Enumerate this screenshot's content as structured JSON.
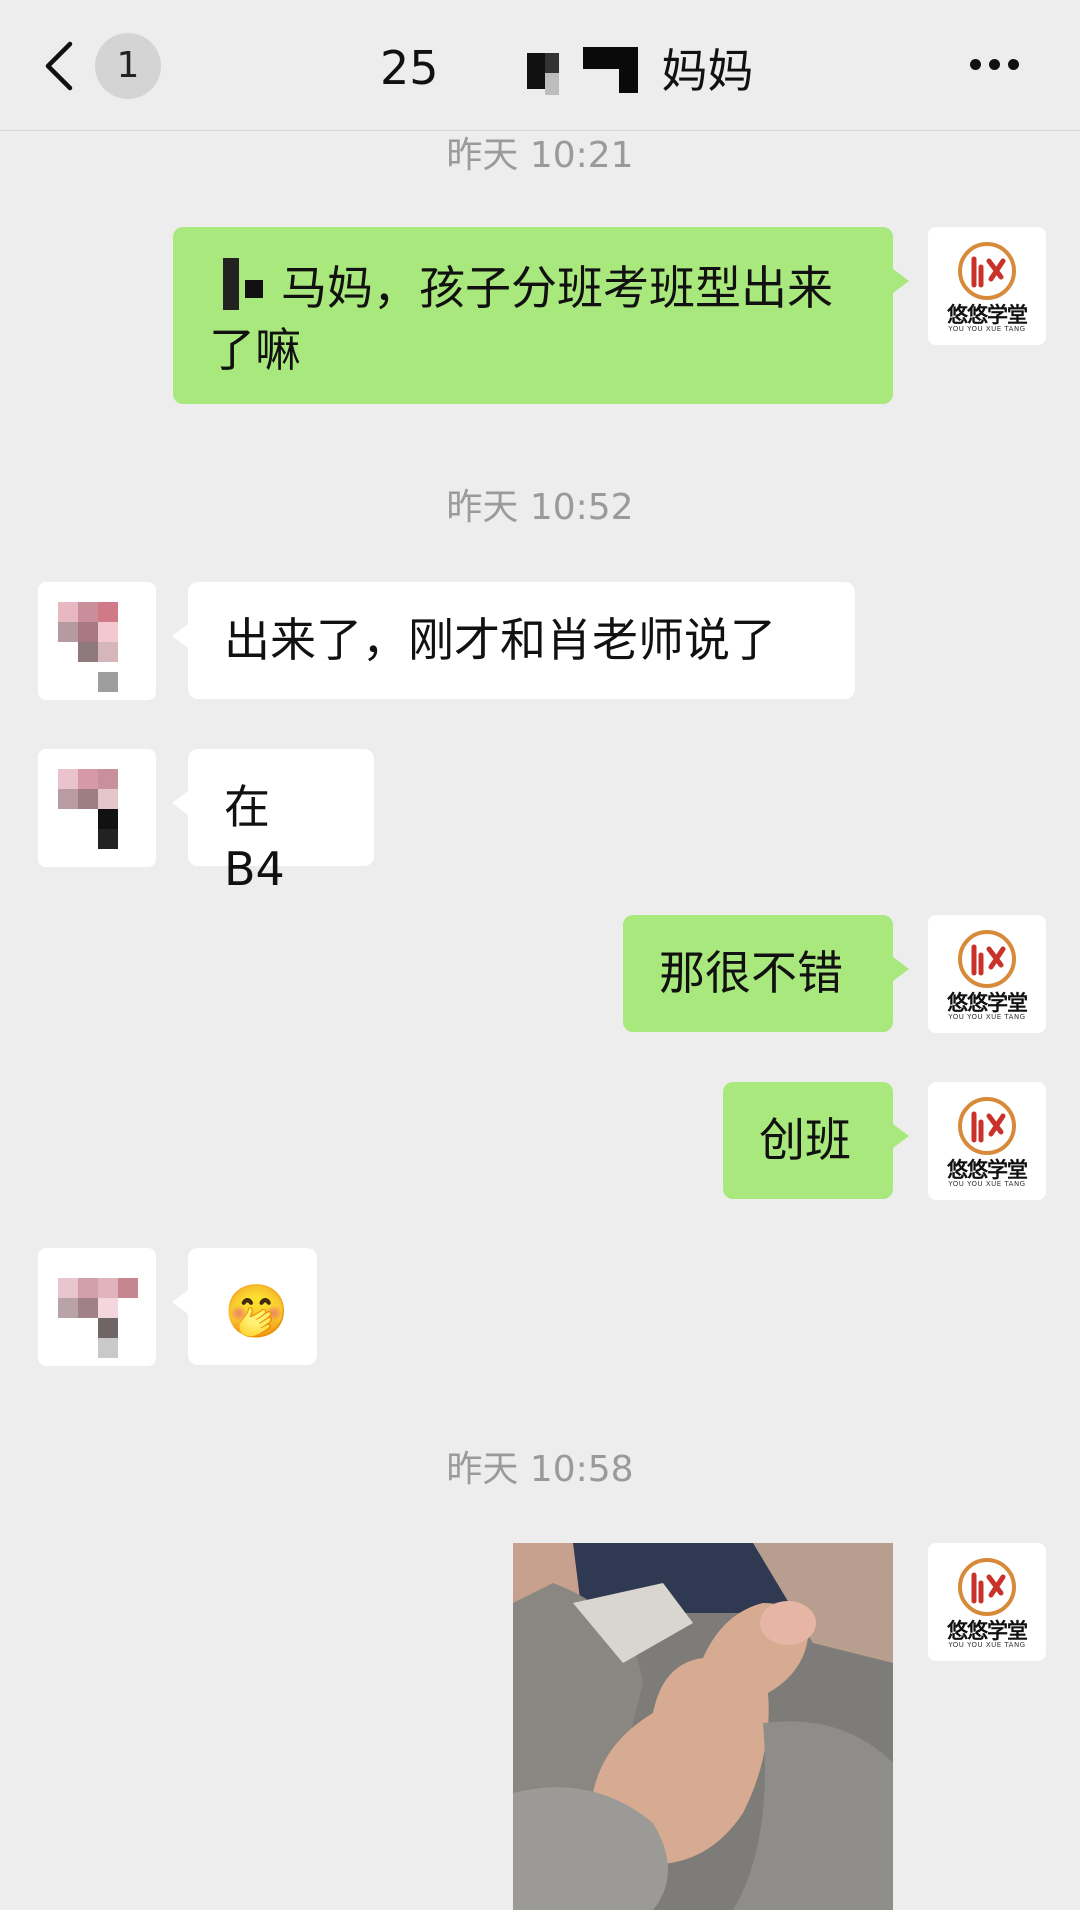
{
  "header": {
    "back_icon": "chevron-left-icon",
    "unread_count": "1",
    "title_prefix": "25",
    "title_suffix": "妈妈",
    "more_icon": "ellipsis-icon"
  },
  "messages": [
    {
      "type": "timestamp",
      "text": "昨天 10:21"
    },
    {
      "type": "text",
      "side": "out",
      "text_visible": "马妈，孩子分班考班型出来了嘛"
    },
    {
      "type": "timestamp",
      "text": "昨天 10:52"
    },
    {
      "type": "text",
      "side": "in",
      "text": "出来了，刚才和肖老师说了"
    },
    {
      "type": "text",
      "side": "in",
      "text": "在 B4"
    },
    {
      "type": "text",
      "side": "out",
      "text": "那很不错"
    },
    {
      "type": "text",
      "side": "out",
      "text": "创班"
    },
    {
      "type": "emoji",
      "side": "in",
      "emoji": "🤭"
    },
    {
      "type": "timestamp",
      "text": "昨天 10:58"
    },
    {
      "type": "image",
      "side": "out"
    }
  ],
  "brand": {
    "name": "悠悠学堂",
    "subtitle": "YOU YOU XUE TANG",
    "accent": "#c8322b"
  },
  "colors": {
    "background": "#ededed",
    "outgoing_bubble": "#a9e87c",
    "incoming_bubble": "#ffffff",
    "timestamp": "#9a9a9a"
  }
}
